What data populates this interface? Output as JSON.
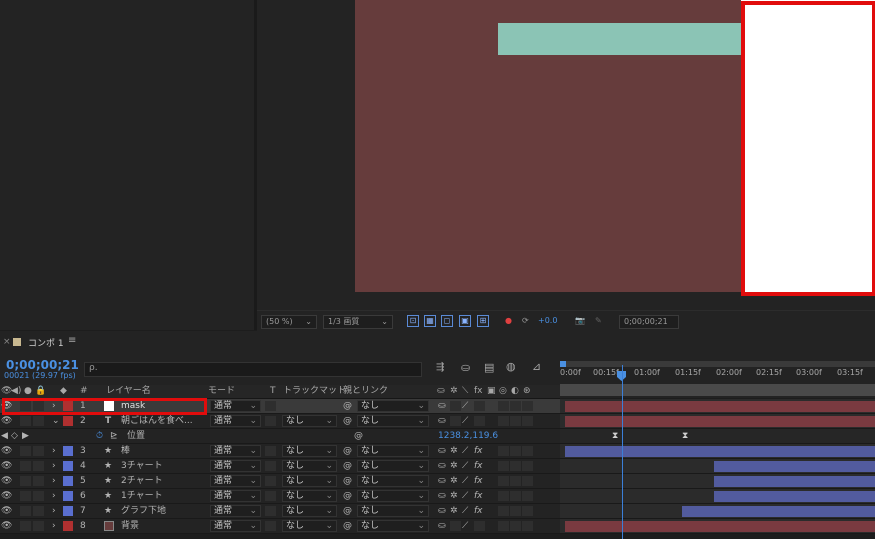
{
  "viewer": {
    "zoom": "(50 %)",
    "resolution": "1/3 画質",
    "exposure": "+0.0",
    "timecode": "0;00;00;21",
    "colors": {
      "canvas": "#663c3c",
      "teal": "#8bc4b5",
      "white": "#ffffff",
      "highlight": "#e10c0c"
    }
  },
  "timeline": {
    "tab_title": "コンポ 1",
    "menu_icon": "hamburger-icon",
    "current_time": "0;00;00;21",
    "frame_info": "00021 (29.97 fps)",
    "search_placeholder": "ρ.",
    "columns": {
      "hash": "#",
      "layer_name": "レイヤー名",
      "mode": "モード",
      "t": "T",
      "track_matte": "トラックマット",
      "parent_link": "親とリンク"
    },
    "ruler_ticks": [
      "0:00f",
      "00:15f",
      "01:00f",
      "01:15f",
      "02:00f",
      "02:15f",
      "03:00f",
      "03:15f"
    ],
    "layers": [
      {
        "num": "1",
        "name": "mask",
        "mode": "通常",
        "matte": "",
        "parent": "なし",
        "label_color": "#b03030",
        "icon": "solid-white",
        "fx": false
      },
      {
        "num": "2",
        "name": "朝ごはんを食べ...",
        "mode": "通常",
        "matte": "なし",
        "parent": "なし",
        "label_color": "#b03030",
        "icon": "text-layer-icon",
        "fx": false
      },
      {
        "num": "3",
        "name": "棒",
        "mode": "通常",
        "matte": "なし",
        "parent": "なし",
        "label_color": "#5a6fd0",
        "icon": "star-icon",
        "fx": true
      },
      {
        "num": "4",
        "name": "3チャート",
        "mode": "通常",
        "matte": "なし",
        "parent": "なし",
        "label_color": "#5a6fd0",
        "icon": "star-icon",
        "fx": true
      },
      {
        "num": "5",
        "name": "2チャート",
        "mode": "通常",
        "matte": "なし",
        "parent": "なし",
        "label_color": "#5a6fd0",
        "icon": "star-icon",
        "fx": true
      },
      {
        "num": "6",
        "name": "1チャート",
        "mode": "通常",
        "matte": "なし",
        "parent": "なし",
        "label_color": "#5a6fd0",
        "icon": "star-icon",
        "fx": true
      },
      {
        "num": "7",
        "name": "グラフ下地",
        "mode": "通常",
        "matte": "なし",
        "parent": "なし",
        "label_color": "#5a6fd0",
        "icon": "star-icon",
        "fx": true
      },
      {
        "num": "8",
        "name": "背景",
        "mode": "通常",
        "matte": "なし",
        "parent": "なし",
        "label_color": "#b03030",
        "icon": "solid-maroon",
        "fx": false
      }
    ],
    "property": {
      "name": "位置",
      "value": "1238.2,119.6"
    },
    "colors": {
      "red_bar": "#7a3a40",
      "blue_bar": "#525b9e",
      "playhead": "#3b7fd8",
      "time_blue": "#4a90e2"
    }
  }
}
